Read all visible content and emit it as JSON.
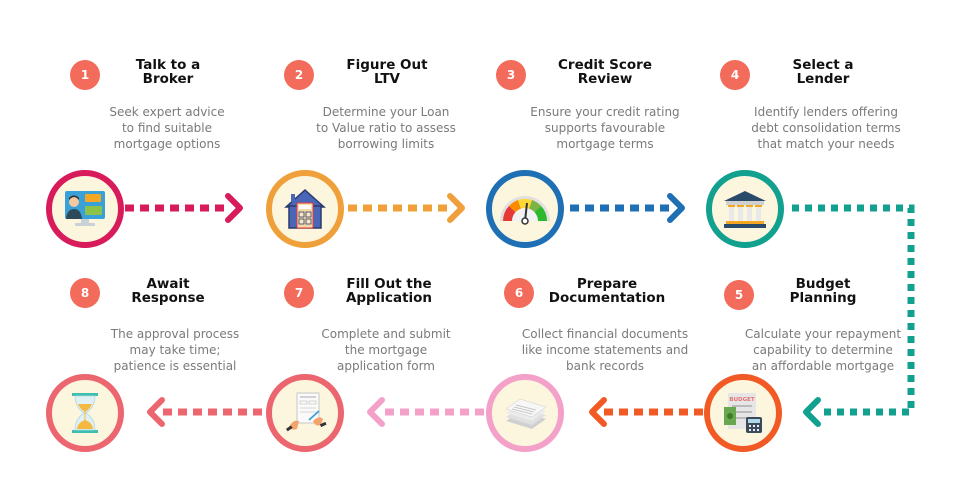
{
  "steps": [
    {
      "number": "1",
      "title": [
        "Talk to a",
        "Broker"
      ],
      "desc": [
        "Seek expert advice",
        "to find suitable",
        "mortgage options"
      ],
      "icon": "video-call-icon",
      "color": "#d81b5a"
    },
    {
      "number": "2",
      "title": [
        "Figure Out",
        "LTV"
      ],
      "desc": [
        "Determine your Loan",
        "to Value ratio to assess",
        "borrowing limits"
      ],
      "icon": "house-calculator-icon",
      "color": "#f0a03a"
    },
    {
      "number": "3",
      "title": [
        "Credit Score",
        "Review"
      ],
      "desc": [
        "Ensure your credit rating",
        "supports favourable",
        "mortgage terms"
      ],
      "icon": "credit-gauge-icon",
      "color": "#1f6fb5"
    },
    {
      "number": "4",
      "title": [
        "Select a",
        "Lender"
      ],
      "desc": [
        "Identify lenders offering",
        "debt consolidation terms",
        "that match your needs"
      ],
      "icon": "bank-icon",
      "color": "#12a08f"
    },
    {
      "number": "5",
      "title": [
        "Budget",
        "Planning"
      ],
      "desc": [
        "Calculate your repayment",
        "capability to determine",
        "an affordable mortgage"
      ],
      "icon": "budget-icon",
      "color": "#f15a24"
    },
    {
      "number": "6",
      "title": [
        "Prepare",
        "Documentation"
      ],
      "desc": [
        "Collect financial documents",
        "like income statements and",
        "bank records"
      ],
      "icon": "documents-icon",
      "color": "#f3a1c8"
    },
    {
      "number": "7",
      "title": [
        "Fill Out the",
        "Application"
      ],
      "desc": [
        "Complete and submit",
        "the mortgage",
        "application form"
      ],
      "icon": "signing-form-icon",
      "color": "#ec6670"
    },
    {
      "number": "8",
      "title": [
        "Await",
        "Response"
      ],
      "desc": [
        "The approval process",
        "may take time;",
        "patience is essential"
      ],
      "icon": "hourglass-icon",
      "color": "#ec6670"
    }
  ],
  "budget_label": "BUDGET"
}
